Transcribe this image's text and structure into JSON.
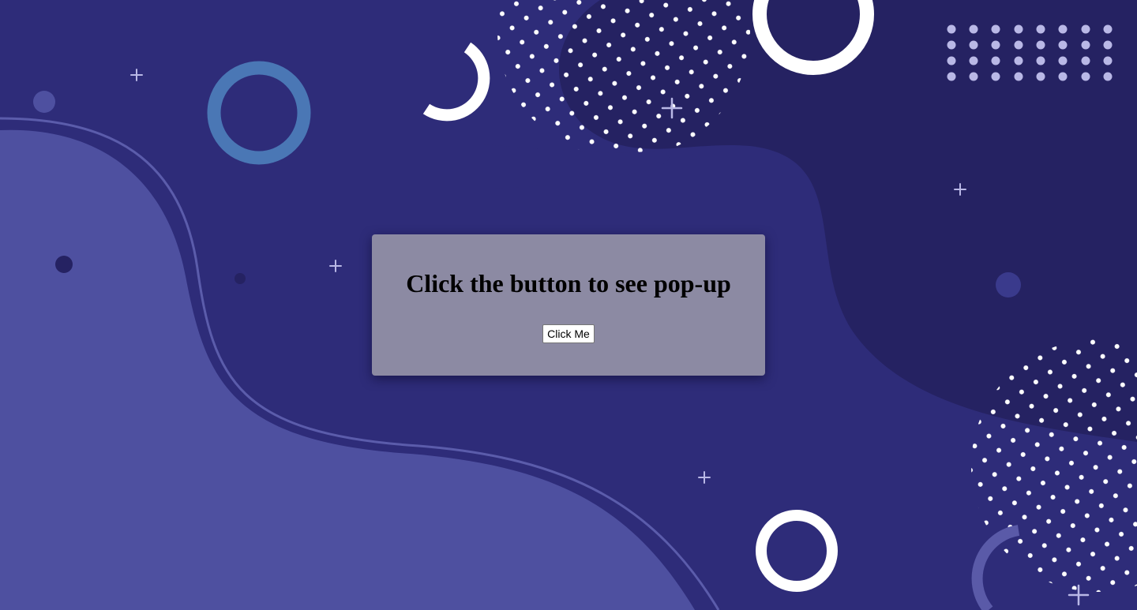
{
  "popup_card": {
    "heading": "Click the button to see pop-up",
    "button_label": "Click Me"
  },
  "colors": {
    "background": "#2e2c79",
    "blob_light": "#4e50a0",
    "blob_dark": "#252262",
    "card": "#8c8aa3",
    "ring_blue": "#4a77b5",
    "white": "#ffffff",
    "sparkle": "#b9b8e6"
  }
}
